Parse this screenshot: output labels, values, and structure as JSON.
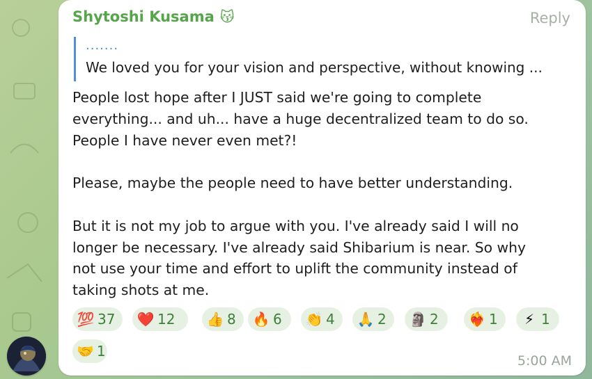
{
  "message": {
    "sender": "Shytoshi Kusama",
    "sender_emoji": "😽",
    "reply_label": "Reply",
    "quote": {
      "dots": ".......",
      "text": "We loved you for your vision and perspective, without knowing ..."
    },
    "lines": [
      "People lost hope after I JUST said we're going to complete",
      "everything... and uh... have a huge decentralized team to do so.",
      "People I have never even met?!",
      "",
      "Please, maybe the people need to have better understanding.",
      "",
      "But it is not my job to argue with you. I've already said I will no",
      "longer be necessary.  I've already said Shibarium is near. So why",
      "not use your time and effort to uplift the community instead of",
      "taking shots at me."
    ],
    "reactions": [
      {
        "emoji": "💯",
        "count": "37",
        "name": "hundred"
      },
      {
        "emoji": "❤️",
        "count": "12",
        "name": "heart"
      },
      {
        "emoji": "👍",
        "count": "8",
        "name": "thumbs-up"
      },
      {
        "emoji": "🔥",
        "count": "6",
        "name": "fire"
      },
      {
        "emoji": "👏",
        "count": "4",
        "name": "clap"
      },
      {
        "emoji": "🙏",
        "count": "2",
        "name": "pray"
      },
      {
        "emoji": "🗿",
        "count": "2",
        "name": "moai"
      },
      {
        "emoji": "❤️‍🔥",
        "count": "1",
        "name": "heart-on-fire"
      },
      {
        "emoji": "⚡",
        "count": "1",
        "name": "lightning"
      },
      {
        "emoji": "🤝",
        "count": "1",
        "name": "handshake"
      }
    ],
    "time": "5:00 AM"
  },
  "colors": {
    "sender": "#56a54a",
    "quote_bar": "#4e8fd6",
    "reaction_bg": "#e7f1e3",
    "reaction_count": "#3e7f3a",
    "meta": "#9aa59b"
  }
}
